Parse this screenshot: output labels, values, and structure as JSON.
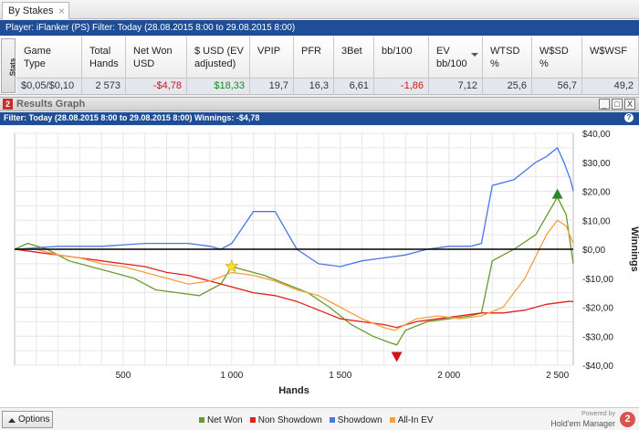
{
  "tab": {
    "label": "By Stakes",
    "close": "×"
  },
  "filter_bar": "Player: iFlanker (PS)   Filter: Today (28.08.2015 8:00 to 29.08.2015 8:00)",
  "stats": {
    "side_label": "Stats",
    "headers": [
      "Game\nType",
      "Total\nHands",
      "Net Won\nUSD",
      "$ USD (EV\nadjusted)",
      "VPIP",
      "PFR",
      "3Bet",
      "bb/100",
      "EV\nbb/100",
      "WTSD\n%",
      "W$SD\n%",
      "W$WSF"
    ],
    "row": [
      "$0,05/$0,10",
      "2 573",
      "-$4,78",
      "$18,33",
      "19,7",
      "16,3",
      "6,61",
      "-1,86",
      "7,12",
      "25,6",
      "56,7",
      "49,2"
    ]
  },
  "results_panel": {
    "title": "Results Graph",
    "logo": "2",
    "minimize": "_",
    "maximize": "□",
    "close": "X",
    "filter": "Filter: Today (28.08.2015 8:00 to 29.08.2015 8:00)  Winnings: -$4,78",
    "help": "?"
  },
  "chart_data": {
    "type": "line",
    "xlabel": "Hands",
    "ylabel": "Winnings",
    "xlim": [
      0,
      2573
    ],
    "ylim": [
      -40,
      40
    ],
    "x_ticks": [
      "500",
      "1 000",
      "1 500",
      "2 000",
      "2 500"
    ],
    "x_tick_values": [
      500,
      1000,
      1500,
      2000,
      2500
    ],
    "y_ticks": [
      "$40,00",
      "$30,00",
      "$20,00",
      "$10,00",
      "$0,00",
      "-$10,00",
      "-$20,00",
      "-$30,00",
      "-$40,00"
    ],
    "y_tick_values": [
      40,
      30,
      20,
      10,
      0,
      -10,
      -20,
      -30,
      -40
    ],
    "grid": true,
    "series": [
      {
        "name": "Net Won",
        "color": "#6a9a2e",
        "x": [
          0,
          60,
          150,
          250,
          350,
          450,
          550,
          650,
          750,
          850,
          950,
          1000,
          1050,
          1150,
          1250,
          1350,
          1450,
          1550,
          1650,
          1720,
          1760,
          1800,
          1900,
          2000,
          2100,
          2150,
          2200,
          2300,
          2400,
          2500,
          2540,
          2573
        ],
        "values": [
          0,
          2,
          0,
          -4,
          -6,
          -8,
          -10,
          -14,
          -15,
          -16,
          -12,
          -6,
          -7,
          -9,
          -12,
          -15,
          -20,
          -26,
          -30,
          -32,
          -33,
          -28,
          -25,
          -24,
          -23,
          -22,
          -4,
          0,
          5,
          18,
          12,
          -5
        ]
      },
      {
        "name": "Non Showdown",
        "color": "#e02020",
        "x": [
          0,
          100,
          200,
          300,
          400,
          500,
          600,
          700,
          800,
          900,
          1000,
          1100,
          1200,
          1300,
          1400,
          1500,
          1600,
          1700,
          1760,
          1850,
          1950,
          2050,
          2150,
          2250,
          2350,
          2450,
          2550,
          2573
        ],
        "values": [
          0,
          -1,
          -2,
          -3,
          -4,
          -5,
          -6,
          -8,
          -9,
          -11,
          -13,
          -15,
          -16,
          -18,
          -21,
          -24,
          -25,
          -26,
          -27,
          -25,
          -24,
          -23,
          -22,
          -22,
          -21,
          -19,
          -18,
          -18
        ]
      },
      {
        "name": "Showdown",
        "color": "#4a76e8",
        "x": [
          0,
          200,
          400,
          600,
          800,
          900,
          950,
          1000,
          1100,
          1200,
          1300,
          1400,
          1500,
          1600,
          1700,
          1800,
          1900,
          2000,
          2100,
          2150,
          2200,
          2300,
          2400,
          2450,
          2500,
          2530,
          2560,
          2573
        ],
        "values": [
          0,
          1,
          1,
          2,
          2,
          1,
          0,
          2,
          13,
          13,
          0,
          -5,
          -6,
          -4,
          -3,
          -2,
          0,
          1,
          1,
          2,
          22,
          24,
          30,
          32,
          35,
          30,
          24,
          20
        ]
      },
      {
        "name": "All-In EV",
        "color": "#f5a040",
        "x": [
          0,
          100,
          200,
          300,
          400,
          500,
          600,
          700,
          800,
          900,
          1000,
          1100,
          1200,
          1300,
          1400,
          1500,
          1600,
          1700,
          1750,
          1850,
          1950,
          2050,
          2150,
          2250,
          2350,
          2450,
          2500,
          2540,
          2573
        ],
        "values": [
          0,
          0,
          -2,
          -3,
          -5,
          -6,
          -8,
          -10,
          -12,
          -11,
          -8,
          -9,
          -11,
          -14,
          -16,
          -20,
          -24,
          -27,
          -28,
          -24,
          -23,
          -24,
          -23,
          -20,
          -10,
          5,
          10,
          8,
          2
        ]
      }
    ],
    "markers": [
      {
        "shape": "star",
        "color": "#ffe02a",
        "x": 1000,
        "y": -6
      },
      {
        "shape": "triangle-up",
        "color": "#2a8a2a",
        "x": 2500,
        "y": 19
      },
      {
        "shape": "triangle-down",
        "color": "#d01414",
        "x": 1760,
        "y": -37
      }
    ],
    "zero_line": true,
    "legend_position": "bottom"
  },
  "bottom": {
    "options": "Options",
    "brand_small": "Powered by",
    "brand": "Hold'em Manager",
    "brand_logo": "2"
  }
}
